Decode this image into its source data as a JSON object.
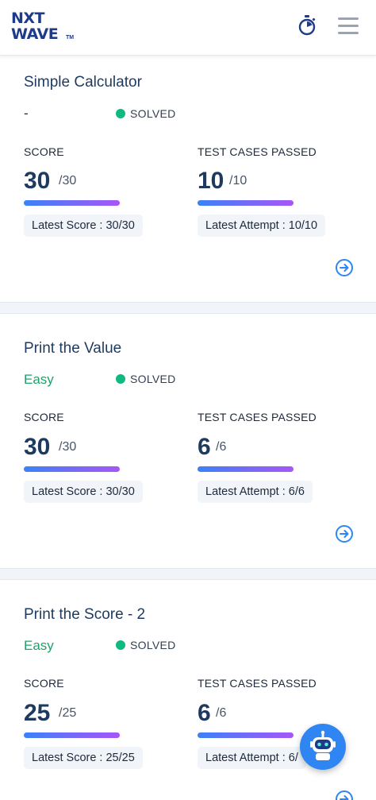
{
  "header": {
    "logo_line1": "NXT",
    "logo_line2": "WAVE",
    "logo_tm": "TM",
    "timer_icon": "stopwatch-icon",
    "menu_icon": "hamburger-menu-icon"
  },
  "labels": {
    "score": "SCORE",
    "test_cases": "TEST CASES PASSED"
  },
  "colors": {
    "brand": "#1e3a8a",
    "solved": "#10b981",
    "easy": "#22a06b",
    "accent": "#2f86f2"
  },
  "problems": [
    {
      "title": "Simple Calculator",
      "difficulty": "-",
      "status": "SOLVED",
      "score": "30",
      "score_total": "/30",
      "test_passed": "10",
      "test_total": "/10",
      "latest_score": "Latest Score : 30/30",
      "latest_attempt": "Latest Attempt : 10/10"
    },
    {
      "title": "Print the Value",
      "difficulty": "Easy",
      "status": "SOLVED",
      "score": "30",
      "score_total": "/30",
      "test_passed": "6",
      "test_total": "/6",
      "latest_score": "Latest Score : 30/30",
      "latest_attempt": "Latest Attempt : 6/6"
    },
    {
      "title": "Print the Score - 2",
      "difficulty": "Easy",
      "status": "SOLVED",
      "score": "25",
      "score_total": "/25",
      "test_passed": "6",
      "test_total": "/6",
      "latest_score": "Latest Score : 25/25",
      "latest_attempt": "Latest Attempt : 6/"
    }
  ],
  "chat_bot_icon": "robot-icon"
}
